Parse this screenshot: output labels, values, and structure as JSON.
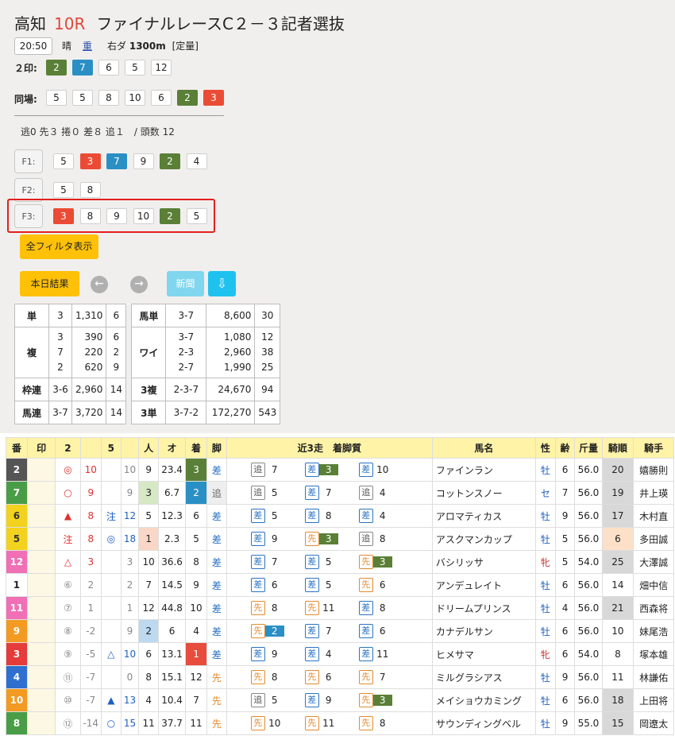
{
  "header": {
    "venue": "高知",
    "race_no": "10R",
    "race_name": "ファイナルレースC２－３記者選抜",
    "time": "20:50",
    "weather": "晴",
    "track_condition": "重",
    "course": "右ダ",
    "distance": "1300m",
    "weight_rule": "[定量]"
  },
  "marks_row": {
    "label": "２印:",
    "numbers": [
      {
        "n": "2",
        "c": "green"
      },
      {
        "n": "7",
        "c": "blue"
      },
      {
        "n": "6",
        "c": ""
      },
      {
        "n": "5",
        "c": ""
      },
      {
        "n": "12",
        "c": ""
      }
    ]
  },
  "same_row": {
    "label": "同場:",
    "numbers": [
      {
        "n": "5",
        "c": ""
      },
      {
        "n": "5",
        "c": ""
      },
      {
        "n": "8",
        "c": ""
      },
      {
        "n": "10",
        "c": ""
      },
      {
        "n": "6",
        "c": ""
      },
      {
        "n": "2",
        "c": "green"
      },
      {
        "n": "3",
        "c": "red"
      }
    ]
  },
  "style_stats": "逃0 先３ 捲０ 差８ 追１　/ 頭数 12",
  "filters": [
    {
      "label": "F1:",
      "numbers": [
        {
          "n": "5",
          "c": ""
        },
        {
          "n": "3",
          "c": "red"
        },
        {
          "n": "7",
          "c": "blue"
        },
        {
          "n": "9",
          "c": ""
        },
        {
          "n": "2",
          "c": "green"
        },
        {
          "n": "4",
          "c": ""
        }
      ]
    },
    {
      "label": "F2:",
      "numbers": [
        {
          "n": "5",
          "c": ""
        },
        {
          "n": "8",
          "c": ""
        }
      ]
    },
    {
      "label": "F3:",
      "numbers": [
        {
          "n": "3",
          "c": "red"
        },
        {
          "n": "8",
          "c": ""
        },
        {
          "n": "9",
          "c": ""
        },
        {
          "n": "10",
          "c": ""
        },
        {
          "n": "2",
          "c": "green"
        },
        {
          "n": "5",
          "c": ""
        }
      ]
    }
  ],
  "buttons": {
    "all_filters": "全フィルタ表示",
    "today_results": "本日結果",
    "prev_icon": "←",
    "next_icon": "→",
    "news": "新聞",
    "download_icon": "⇩"
  },
  "payouts": {
    "win": {
      "label": "単",
      "combo": "3",
      "pay": "1,310",
      "pop": "6"
    },
    "place": {
      "label": "複",
      "combos": [
        "3",
        "7",
        "2"
      ],
      "pays": [
        "390",
        "220",
        "620"
      ],
      "pops": [
        "6",
        "2",
        "9"
      ]
    },
    "bracket_quinella": {
      "label": "枠連",
      "combo": "3-6",
      "pay": "2,960",
      "pop": "14"
    },
    "quinella": {
      "label": "馬連",
      "combo": "3-7",
      "pay": "3,720",
      "pop": "14"
    },
    "exacta": {
      "label": "馬単",
      "combo": "3-7",
      "pay": "8,600",
      "pop": "30"
    },
    "wide": {
      "label": "ワイ",
      "combos": [
        "3-7",
        "2-3",
        "2-7"
      ],
      "pays": [
        "1,080",
        "2,960",
        "1,990"
      ],
      "pops": [
        "12",
        "38",
        "25"
      ]
    },
    "trio": {
      "label": "3複",
      "combo": "2-3-7",
      "pay": "24,670",
      "pop": "94"
    },
    "trifecta": {
      "label": "3単",
      "combo": "3-7-2",
      "pay": "172,270",
      "pop": "543"
    }
  },
  "table_headers": [
    "番",
    "印",
    "2",
    "",
    "5",
    "",
    "人",
    "オ",
    "着",
    "脚",
    "近3走　着脚質",
    "馬名",
    "性",
    "齢",
    "斤量",
    "騎順",
    "騎手"
  ],
  "runners": [
    {
      "num": "2",
      "ban": 2,
      "m2": "◎",
      "m2c": "red",
      "m2n": "10",
      "m5": "",
      "m5c": "",
      "m5n": "10",
      "m5nc": "gray",
      "pop": "9",
      "popbg": "",
      "odds": "23.4",
      "fin": "3",
      "finc": "fin3",
      "leg": "差",
      "legc": "leg-blue",
      "past": [
        [
          "追",
          "7",
          ""
        ],
        [
          "差",
          "3",
          "b3"
        ],
        [
          "差",
          "10",
          ""
        ]
      ],
      "pastc": [
        "gray",
        "blue",
        "blue"
      ],
      "name": "ファインラン",
      "sex": "牡",
      "sexc": "sex-blue",
      "age": "6",
      "wt": "56.0",
      "rank": "20",
      "rankc": "rankbg",
      "jockey": "嬉勝則"
    },
    {
      "num": "7",
      "ban": 6,
      "m2": "○",
      "m2c": "red",
      "m2n": "9",
      "m5": "",
      "m5c": "",
      "m5n": "9",
      "m5nc": "gray",
      "pop": "3",
      "popbg": "popbg-green",
      "odds": "6.7",
      "fin": "2",
      "finc": "fin2",
      "leg": "追",
      "legc": "leg-gray",
      "past": [
        [
          "追",
          "5",
          ""
        ],
        [
          "差",
          "7",
          ""
        ],
        [
          "追",
          "4",
          ""
        ]
      ],
      "pastc": [
        "gray",
        "blue",
        "gray"
      ],
      "name": "コットンスノー",
      "sex": "セ",
      "sexc": "sex-blue",
      "age": "7",
      "wt": "56.0",
      "rank": "19",
      "rankc": "rankbg",
      "jockey": "井上瑛"
    },
    {
      "num": "6",
      "ban": 5,
      "m2": "▲",
      "m2c": "red",
      "m2n": "8",
      "m5": "注",
      "m5c": "blue",
      "m5n": "12",
      "m5nc": "blue",
      "pop": "5",
      "popbg": "",
      "odds": "12.3",
      "fin": "6",
      "finc": "",
      "leg": "差",
      "legc": "leg-blue",
      "past": [
        [
          "差",
          "5",
          ""
        ],
        [
          "差",
          "8",
          ""
        ],
        [
          "差",
          "4",
          ""
        ]
      ],
      "pastc": [
        "blue",
        "blue",
        "blue"
      ],
      "name": "アロマティカス",
      "sex": "牡",
      "sexc": "sex-blue",
      "age": "9",
      "wt": "56.0",
      "rank": "17",
      "rankc": "rankbg",
      "jockey": "木村直"
    },
    {
      "num": "5",
      "ban": 5,
      "m2": "注",
      "m2c": "red",
      "m2n": "8",
      "m5": "◎",
      "m5c": "blue",
      "m5n": "18",
      "m5nc": "blue",
      "pop": "1",
      "popbg": "popbg-peach",
      "odds": "2.3",
      "fin": "5",
      "finc": "",
      "leg": "差",
      "legc": "leg-blue",
      "past": [
        [
          "差",
          "9",
          ""
        ],
        [
          "先",
          "3",
          "b3"
        ],
        [
          "追",
          "8",
          ""
        ]
      ],
      "pastc": [
        "blue",
        "orange",
        "gray"
      ],
      "name": "アスクマンカップ",
      "sex": "牡",
      "sexc": "sex-blue",
      "age": "5",
      "wt": "56.0",
      "rank": "6",
      "rankc": "rankpeach",
      "jockey": "多田誠"
    },
    {
      "num": "12",
      "ban": 8,
      "m2": "△",
      "m2c": "red",
      "m2n": "3",
      "m5": "",
      "m5c": "",
      "m5n": "3",
      "m5nc": "gray",
      "pop": "10",
      "popbg": "",
      "odds": "36.6",
      "fin": "8",
      "finc": "",
      "leg": "差",
      "legc": "leg-blue",
      "past": [
        [
          "差",
          "7",
          ""
        ],
        [
          "差",
          "5",
          ""
        ],
        [
          "先",
          "3",
          "b3"
        ]
      ],
      "pastc": [
        "blue",
        "blue",
        "orange"
      ],
      "name": "バシリッサ",
      "sex": "牝",
      "sexc": "sex-red",
      "age": "5",
      "wt": "54.0",
      "rank": "25",
      "rankc": "rankbg",
      "jockey": "大澤誠"
    },
    {
      "num": "1",
      "ban": 1,
      "m2": "⑥",
      "m2c": "gray",
      "m2n": "2",
      "m5": "",
      "m5c": "",
      "m5n": "2",
      "m5nc": "gray",
      "pop": "7",
      "popbg": "",
      "odds": "14.5",
      "fin": "9",
      "finc": "",
      "leg": "差",
      "legc": "leg-blue",
      "past": [
        [
          "差",
          "6",
          ""
        ],
        [
          "差",
          "5",
          ""
        ],
        [
          "先",
          "6",
          ""
        ]
      ],
      "pastc": [
        "blue",
        "blue",
        "orange"
      ],
      "name": "アンデュレイト",
      "sex": "牡",
      "sexc": "sex-blue",
      "age": "6",
      "wt": "56.0",
      "rank": "14",
      "rankc": "",
      "jockey": "畑中信"
    },
    {
      "num": "11",
      "ban": 8,
      "m2": "⑦",
      "m2c": "gray",
      "m2n": "1",
      "m5": "",
      "m5c": "",
      "m5n": "1",
      "m5nc": "gray",
      "pop": "12",
      "popbg": "",
      "odds": "44.8",
      "fin": "10",
      "finc": "",
      "leg": "差",
      "legc": "leg-blue",
      "past": [
        [
          "先",
          "8",
          ""
        ],
        [
          "先",
          "11",
          ""
        ],
        [
          "差",
          "8",
          ""
        ]
      ],
      "pastc": [
        "orange",
        "orange",
        "blue"
      ],
      "name": "ドリームプリンス",
      "sex": "牡",
      "sexc": "sex-blue",
      "age": "4",
      "wt": "56.0",
      "rank": "21",
      "rankc": "rankbg",
      "jockey": "西森将"
    },
    {
      "num": "9",
      "ban": 7,
      "m2": "⑧",
      "m2c": "gray",
      "m2n": "-2",
      "m5": "",
      "m5c": "",
      "m5n": "9",
      "m5nc": "gray",
      "pop": "2",
      "popbg": "popbg-blue",
      "odds": "6",
      "fin": "4",
      "finc": "",
      "leg": "差",
      "legc": "leg-blue",
      "past": [
        [
          "先",
          "2",
          "b2"
        ],
        [
          "差",
          "7",
          ""
        ],
        [
          "差",
          "6",
          ""
        ]
      ],
      "pastc": [
        "orange",
        "blue",
        "blue"
      ],
      "name": "カナデルサン",
      "sex": "牡",
      "sexc": "sex-blue",
      "age": "6",
      "wt": "56.0",
      "rank": "10",
      "rankc": "",
      "jockey": "妹尾浩"
    },
    {
      "num": "3",
      "ban": 3,
      "m2": "⑨",
      "m2c": "gray",
      "m2n": "-5",
      "m5": "△",
      "m5c": "blue",
      "m5n": "10",
      "m5nc": "blue",
      "pop": "6",
      "popbg": "",
      "odds": "13.1",
      "fin": "1",
      "finc": "fin1",
      "leg": "差",
      "legc": "leg-blue",
      "past": [
        [
          "差",
          "9",
          ""
        ],
        [
          "差",
          "4",
          ""
        ],
        [
          "差",
          "11",
          ""
        ]
      ],
      "pastc": [
        "blue",
        "blue",
        "blue"
      ],
      "name": "ヒメサマ",
      "sex": "牝",
      "sexc": "sex-red",
      "age": "6",
      "wt": "54.0",
      "rank": "8",
      "rankc": "",
      "jockey": "塚本雄"
    },
    {
      "num": "4",
      "ban": 4,
      "m2": "⑪",
      "m2c": "gray",
      "m2n": "-7",
      "m5": "",
      "m5c": "",
      "m5n": "0",
      "m5nc": "gray",
      "pop": "8",
      "popbg": "",
      "odds": "15.1",
      "fin": "12",
      "finc": "",
      "leg": "先",
      "legc": "leg-orange",
      "past": [
        [
          "先",
          "8",
          ""
        ],
        [
          "先",
          "6",
          ""
        ],
        [
          "先",
          "7",
          ""
        ]
      ],
      "pastc": [
        "orange",
        "orange",
        "orange"
      ],
      "name": "ミルグラシアス",
      "sex": "牡",
      "sexc": "sex-blue",
      "age": "9",
      "wt": "56.0",
      "rank": "11",
      "rankc": "",
      "jockey": "林謙佑"
    },
    {
      "num": "10",
      "ban": 7,
      "m2": "⑩",
      "m2c": "gray",
      "m2n": "-7",
      "m5": "▲",
      "m5c": "blue",
      "m5n": "13",
      "m5nc": "blue",
      "pop": "4",
      "popbg": "",
      "odds": "10.4",
      "fin": "7",
      "finc": "",
      "leg": "先",
      "legc": "leg-orange",
      "past": [
        [
          "追",
          "5",
          ""
        ],
        [
          "差",
          "9",
          ""
        ],
        [
          "先",
          "3",
          "b3"
        ]
      ],
      "pastc": [
        "gray",
        "blue",
        "orange"
      ],
      "name": "メイショウカミング",
      "sex": "牡",
      "sexc": "sex-blue",
      "age": "6",
      "wt": "56.0",
      "rank": "18",
      "rankc": "rankbg",
      "jockey": "上田将"
    },
    {
      "num": "8",
      "ban": 6,
      "m2": "⑫",
      "m2c": "gray",
      "m2n": "-14",
      "m5": "○",
      "m5c": "blue",
      "m5n": "15",
      "m5nc": "blue",
      "pop": "11",
      "popbg": "",
      "odds": "37.7",
      "fin": "11",
      "finc": "",
      "leg": "先",
      "legc": "leg-orange",
      "past": [
        [
          "先",
          "10",
          ""
        ],
        [
          "先",
          "11",
          ""
        ],
        [
          "先",
          "8",
          ""
        ]
      ],
      "pastc": [
        "orange",
        "orange",
        "orange"
      ],
      "name": "サウンディングベル",
      "sex": "牡",
      "sexc": "sex-blue",
      "age": "9",
      "wt": "55.0",
      "rank": "15",
      "rankc": "rankbg",
      "jockey": "岡遼太"
    }
  ]
}
